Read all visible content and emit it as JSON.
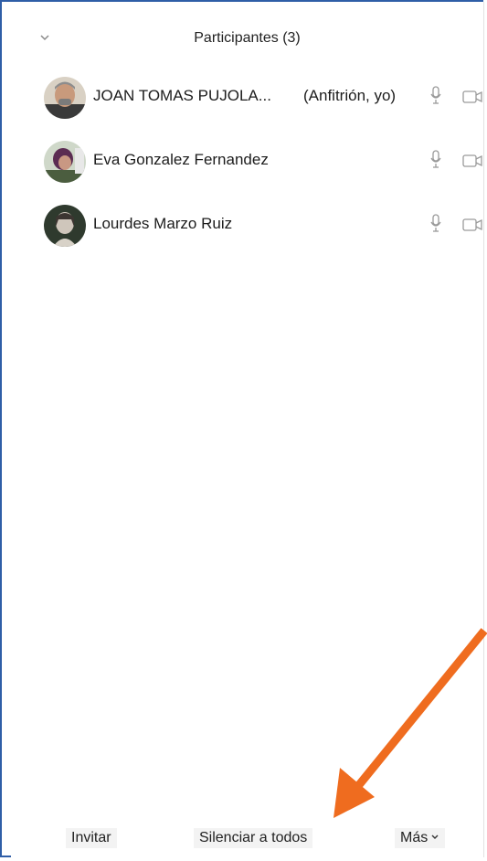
{
  "header": {
    "title": "Participantes (3)"
  },
  "participants": [
    {
      "name": "JOAN TOMAS PUJOLA...",
      "role": "(Anfitrión, yo)"
    },
    {
      "name": "Eva Gonzalez Fernandez"
    },
    {
      "name": "Lourdes Marzo Ruiz"
    }
  ],
  "footer": {
    "invite_label": "Invitar",
    "mute_all_label": "Silenciar a todos",
    "more_label": "Más"
  },
  "colors": {
    "annotation_arrow": "#ef6c1f",
    "frame_border": "#2f5ea7"
  },
  "icons": [
    "chevron-down-icon",
    "microphone-icon",
    "video-camera-icon"
  ]
}
